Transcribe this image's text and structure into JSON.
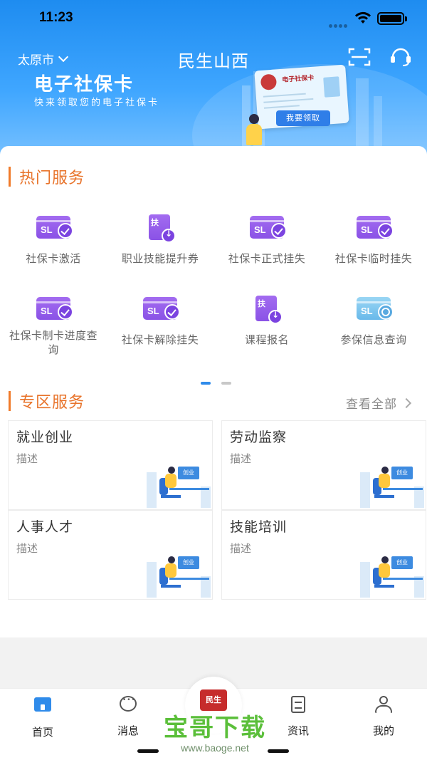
{
  "status_bar": {
    "time": "11:23"
  },
  "header": {
    "city": "太原市",
    "app_title": "民生山西"
  },
  "banner": {
    "title": "电子社保卡",
    "subtitle": "快来领取您的电子社保卡",
    "card_label": "电子社保卡",
    "claim_button": "我要领取"
  },
  "hot_services": {
    "title": "热门服务",
    "items": [
      {
        "label": "社保卡激活",
        "icon": "sl-card-check-icon"
      },
      {
        "label": "职业技能提升券",
        "icon": "doc-download-icon"
      },
      {
        "label": "社保卡正式挂失",
        "icon": "sl-card-check-icon"
      },
      {
        "label": "社保卡临时挂失",
        "icon": "sl-card-check-icon"
      },
      {
        "label": "社保卡制卡进度查询",
        "icon": "sl-card-check-icon"
      },
      {
        "label": "社保卡解除挂失",
        "icon": "sl-card-check-icon"
      },
      {
        "label": "课程报名",
        "icon": "doc-download-icon"
      },
      {
        "label": "参保信息查询",
        "icon": "sl-card-search-icon"
      }
    ],
    "page_count": 2,
    "active_page": 1
  },
  "zone_services": {
    "title": "专区服务",
    "more_label": "查看全部",
    "items": [
      {
        "title": "就业创业",
        "desc": "描述",
        "illus_text": "创业"
      },
      {
        "title": "劳动监察",
        "desc": "描述",
        "illus_text": "创业"
      },
      {
        "title": "人事人才",
        "desc": "描述",
        "illus_text": "创业"
      },
      {
        "title": "技能培训",
        "desc": "描述",
        "illus_text": "创业"
      }
    ]
  },
  "tabbar": {
    "items": [
      {
        "label": "首页",
        "icon": "home-icon",
        "active": true
      },
      {
        "label": "消息",
        "icon": "message-icon",
        "active": false
      },
      {
        "label": "资讯",
        "icon": "news-icon",
        "active": false
      },
      {
        "label": "我的",
        "icon": "user-icon",
        "active": false
      }
    ],
    "center_logo_text": "民生山西"
  },
  "watermark": {
    "brand": "宝哥下载",
    "url": "www.baoge.net"
  },
  "colors": {
    "primary": "#2f8bea",
    "accent": "#e8732a",
    "icon_purple": "#8a52e6",
    "watermark_green": "#5bbf3a"
  }
}
